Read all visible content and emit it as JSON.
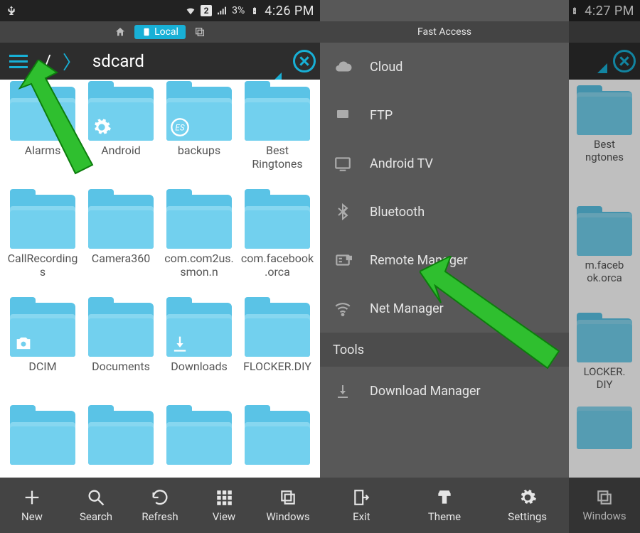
{
  "status": {
    "sim": "2",
    "battery": "3%",
    "time_left": "4:26 PM",
    "time_right": "4:27 PM"
  },
  "tabs": {
    "local": "Local"
  },
  "path": {
    "root": "/",
    "current": "sdcard"
  },
  "folders": [
    {
      "label": "Alarms",
      "overlay": null
    },
    {
      "label": "Android",
      "overlay": "gear"
    },
    {
      "label": "backups",
      "overlay": "es"
    },
    {
      "label": "Best Ringtones",
      "overlay": null
    },
    {
      "label": "CallRecordings",
      "overlay": null
    },
    {
      "label": "Camera360",
      "overlay": null
    },
    {
      "label": "com.com2us.smon.n",
      "overlay": null
    },
    {
      "label": "com.facebook.orca",
      "overlay": null
    },
    {
      "label": "DCIM",
      "overlay": "camera"
    },
    {
      "label": "Documents",
      "overlay": null
    },
    {
      "label": "Downloads",
      "overlay": "download"
    },
    {
      "label": "FLOCKER.DIY",
      "overlay": null
    }
  ],
  "bottom_left": [
    {
      "label": "New",
      "icon": "plus"
    },
    {
      "label": "Search",
      "icon": "search"
    },
    {
      "label": "Refresh",
      "icon": "refresh"
    },
    {
      "label": "View",
      "icon": "grid"
    },
    {
      "label": "Windows",
      "icon": "windows"
    }
  ],
  "drawer": {
    "header": "Fast Access",
    "items": [
      {
        "label": "Cloud",
        "icon": "cloud"
      },
      {
        "label": "FTP",
        "icon": "monitor"
      },
      {
        "label": "Android TV",
        "icon": "tv"
      },
      {
        "label": "Bluetooth",
        "icon": "bluetooth"
      },
      {
        "label": "Remote Manager",
        "icon": "remote"
      },
      {
        "label": "Net Manager",
        "icon": "wifi"
      }
    ],
    "tools_label": "Tools",
    "tools": [
      {
        "label": "Download Manager",
        "icon": "download"
      }
    ],
    "bottom": [
      {
        "label": "Exit",
        "icon": "exit"
      },
      {
        "label": "Theme",
        "icon": "theme"
      },
      {
        "label": "Settings",
        "icon": "gear"
      }
    ]
  },
  "right_partial": {
    "folders_col": [
      "Best Ringtones",
      "com.facebook.orca",
      "FLOCKER.DIY"
    ],
    "bottom_label": "Windows"
  }
}
